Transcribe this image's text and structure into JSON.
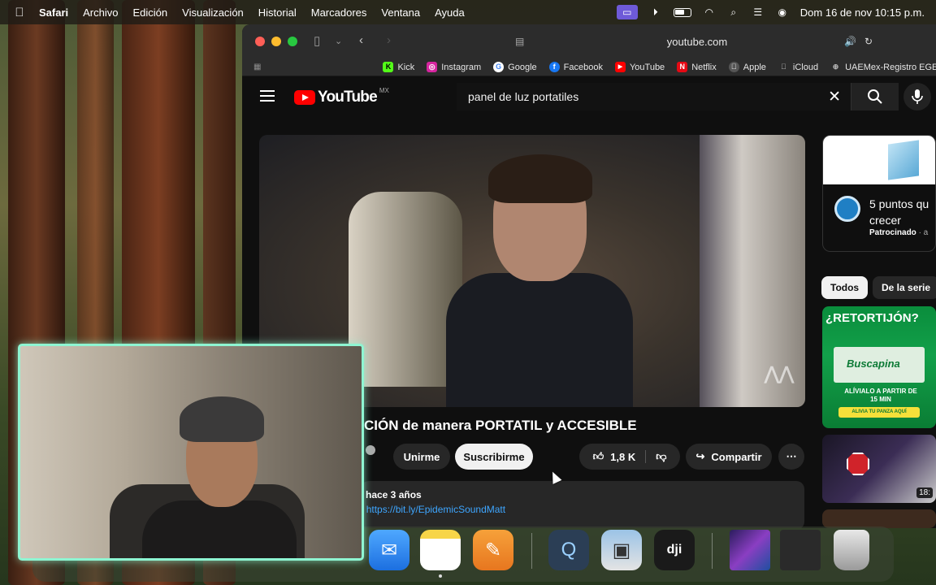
{
  "menubar": {
    "app_name": "Safari",
    "menus": [
      "Archivo",
      "Edición",
      "Visualización",
      "Historial",
      "Marcadores",
      "Ventana",
      "Ayuda"
    ],
    "clock": "Dom 16 de nov  10:15 p.m."
  },
  "browser": {
    "url": "youtube.com",
    "bookmarks": [
      {
        "label": "Kick",
        "icon": "kick-icon",
        "color": "#53fc18"
      },
      {
        "label": "Instagram",
        "icon": "instagram-icon",
        "color": "#d6249f"
      },
      {
        "label": "Google",
        "icon": "google-icon",
        "color": "#4285f4"
      },
      {
        "label": "Facebook",
        "icon": "facebook-icon",
        "color": "#1877f2"
      },
      {
        "label": "YouTube",
        "icon": "youtube-icon",
        "color": "#ff0000"
      },
      {
        "label": "Netflix",
        "icon": "netflix-icon",
        "color": "#e50914"
      },
      {
        "label": "Apple",
        "icon": "apple-icon",
        "color": "#888888"
      },
      {
        "label": "iCloud",
        "icon": "icloud-icon",
        "color": "#cccccc"
      },
      {
        "label": "UAEMex-Registro EGEL",
        "icon": "globe-icon",
        "color": "#999999"
      }
    ]
  },
  "youtube": {
    "logo_text": "YouTube",
    "region": "MX",
    "search_query": "panel de luz portatiles",
    "video": {
      "title": "CIÓN de manera PORTATIL y ACCESIBLE",
      "join_label": "Unirme",
      "subscribe_label": "Suscribirme",
      "likes": "1,8 K",
      "share_label": "Compartir",
      "time_ago": "hace 3 años",
      "link_prefix": ":",
      "link": "https://bit.ly/EpidemicSoundMatt"
    },
    "ad": {
      "title": "5 puntos qu crecer",
      "sponsored": "Patrocinado",
      "sponsored_suffix": "· a"
    },
    "chips": [
      "Todos",
      "De la serie"
    ],
    "thumbnails": [
      {
        "title": "¿RETORTIJÓN?",
        "brand": "Buscapina",
        "subtitle": "ALÍVIALO A PARTIR DE 15 MIN",
        "cta": "ALIVIA TU PANZA AQUÍ"
      },
      {
        "duration": "18:"
      }
    ]
  },
  "colors": {
    "accent": "#ff0000",
    "link": "#3ea6ff",
    "webcam_border": "#8ef5d2"
  }
}
